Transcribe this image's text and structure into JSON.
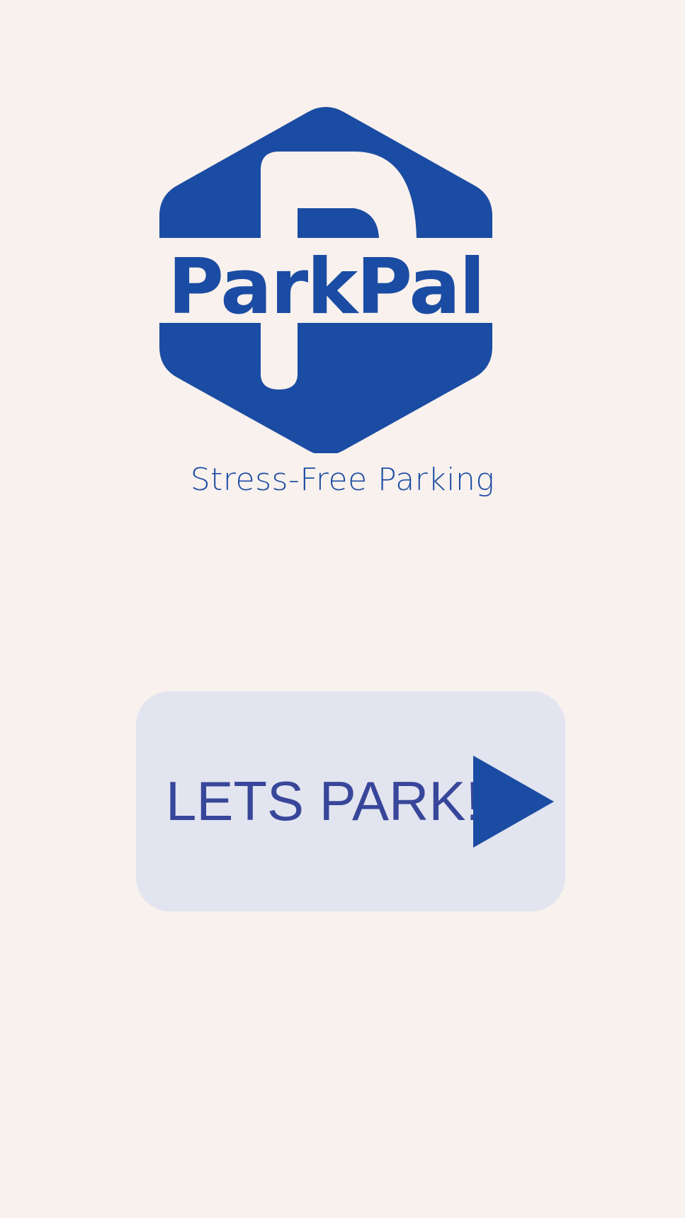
{
  "app": {
    "name": "ParkPal",
    "tagline": "Stress-Free Parking"
  },
  "start_button": {
    "label": "LETS PARK!",
    "icon": "play-icon"
  },
  "colors": {
    "background": "#f8f1ed",
    "brand_blue": "#1b4ca3",
    "button_bg": "#e2e4ef",
    "button_text": "#38469a"
  }
}
